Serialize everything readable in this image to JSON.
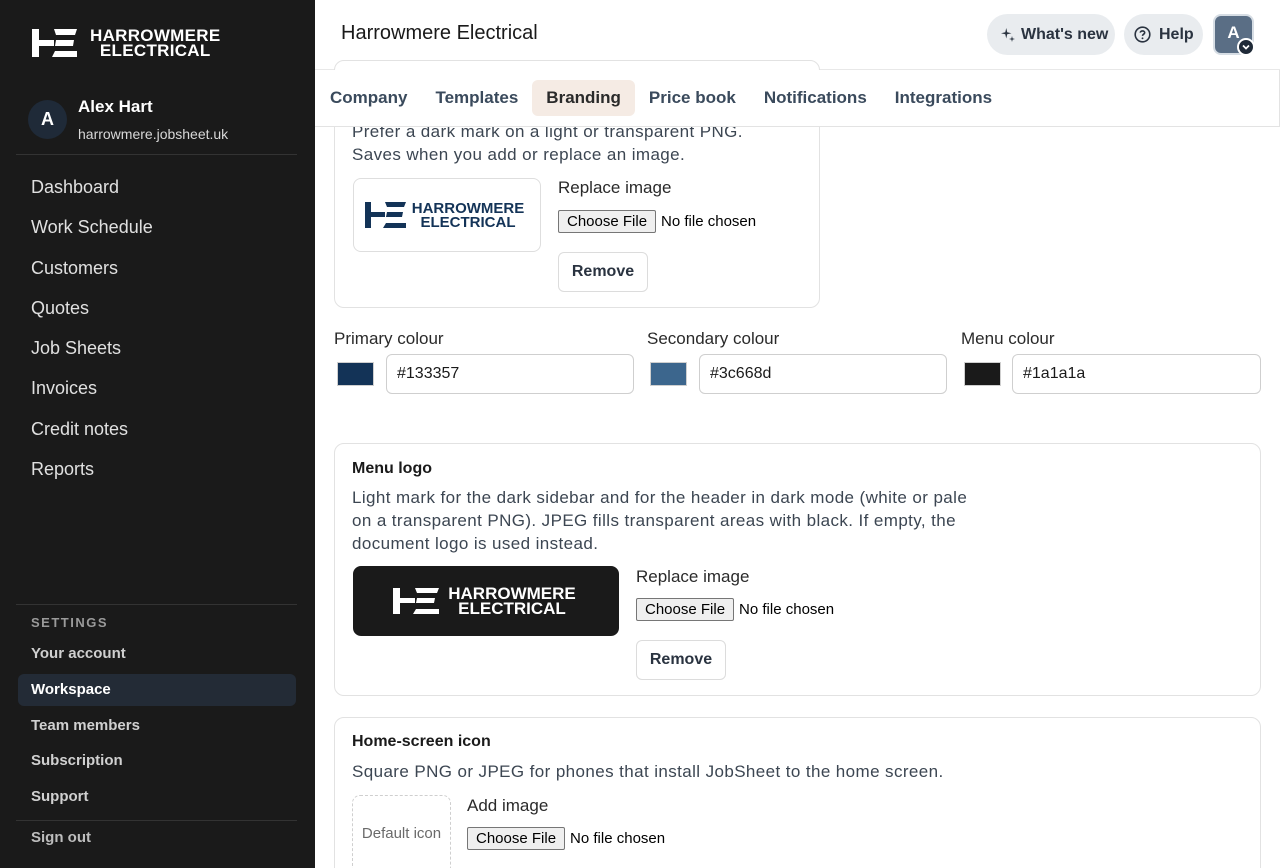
{
  "brand": {
    "logo_line1": "HARROWMERE",
    "logo_line2": "ELECTRICAL",
    "primary": "#133357",
    "secondary": "#3c668d",
    "menu": "#1a1a1a"
  },
  "sidebar": {
    "user_initial": "A",
    "user_name": "Alex Hart",
    "user_domain": "harrowmere.jobsheet.uk",
    "nav": [
      {
        "label": "Dashboard"
      },
      {
        "label": "Work Schedule"
      },
      {
        "label": "Customers"
      },
      {
        "label": "Quotes"
      },
      {
        "label": "Job Sheets"
      },
      {
        "label": "Invoices"
      },
      {
        "label": "Credit notes"
      },
      {
        "label": "Reports"
      }
    ],
    "settings_label": "SETTINGS",
    "settings": [
      {
        "label": "Your account"
      },
      {
        "label": "Workspace"
      },
      {
        "label": "Team members"
      },
      {
        "label": "Subscription"
      },
      {
        "label": "Support"
      }
    ],
    "sign_out": "Sign out"
  },
  "header": {
    "title": "Harrowmere Electrical",
    "whats_new": "What's new",
    "help": "Help",
    "account_initial": "A"
  },
  "tabs": [
    {
      "label": "Company"
    },
    {
      "label": "Templates"
    },
    {
      "label": "Branding"
    },
    {
      "label": "Price book"
    },
    {
      "label": "Notifications"
    },
    {
      "label": "Integrations"
    }
  ],
  "document_logo": {
    "description": "Prefer a dark mark on a light or transparent PNG. Saves when you add or replace an image.",
    "replace_label": "Replace image",
    "file_button": "Choose File",
    "file_status": "No file chosen",
    "remove": "Remove"
  },
  "colours": {
    "primary_label": "Primary colour",
    "primary_value": "#133357",
    "secondary_label": "Secondary colour",
    "secondary_value": "#3c668d",
    "menu_label": "Menu colour",
    "menu_value": "#1a1a1a"
  },
  "menu_logo": {
    "title": "Menu logo",
    "description": "Light mark for the dark sidebar and for the header in dark mode (white or pale on a transparent PNG). JPEG fills transparent areas with black. If empty, the document logo is used instead.",
    "replace_label": "Replace image",
    "file_button": "Choose File",
    "file_status": "No file chosen",
    "remove": "Remove"
  },
  "home_icon": {
    "title": "Home-screen icon",
    "description": "Square PNG or JPEG for phones that install JobSheet to the home screen.",
    "placeholder": "Default icon",
    "add_label": "Add image",
    "file_button": "Choose File",
    "file_status": "No file chosen"
  }
}
